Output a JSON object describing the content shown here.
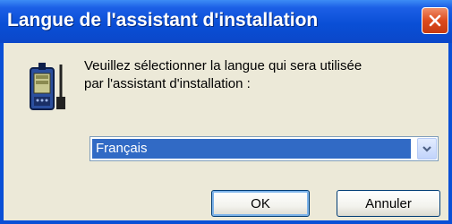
{
  "window": {
    "title": "Langue de l'assistant d'installation"
  },
  "icons": {
    "close": "close-icon",
    "app": "installer-device-icon",
    "dropdown": "chevron-down-icon"
  },
  "prompt": {
    "line1": "Veuillez sélectionner la langue qui sera utilisée",
    "line2": "par l'assistant d'installation :"
  },
  "language_select": {
    "selected": "Français"
  },
  "buttons": {
    "ok_label": "OK",
    "cancel_label": "Annuler"
  },
  "colors": {
    "titlebar": "#0a4fd6",
    "selection": "#316ac5",
    "close": "#dd4b1d",
    "dialog_bg": "#ece9d8"
  }
}
